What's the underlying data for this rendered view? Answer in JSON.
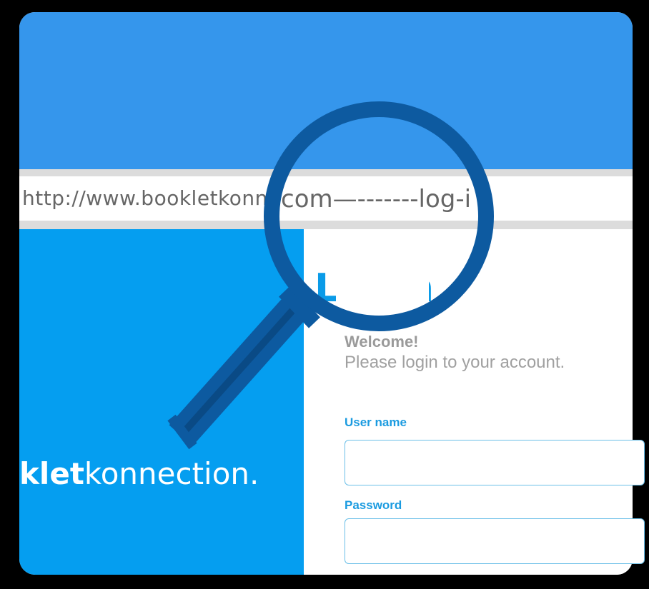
{
  "browser": {
    "url_left": "http://www.bookletkonne",
    "url_magnified": "com—-------log-i"
  },
  "brand": {
    "bold": "klet",
    "regular": "konnection."
  },
  "login": {
    "heading": "Login",
    "welcome": "Welcome!",
    "subtitle": "Please login to your account.",
    "username_label": "User name",
    "password_label": "Password",
    "username_value": "",
    "password_value": ""
  },
  "colors": {
    "top_banner": "#3596ec",
    "left_panel": "#059ef0",
    "accent": "#1b9be0",
    "magnifier": "#0d5aa0"
  },
  "icons": {
    "magnifier": "magnifying-glass-icon"
  }
}
